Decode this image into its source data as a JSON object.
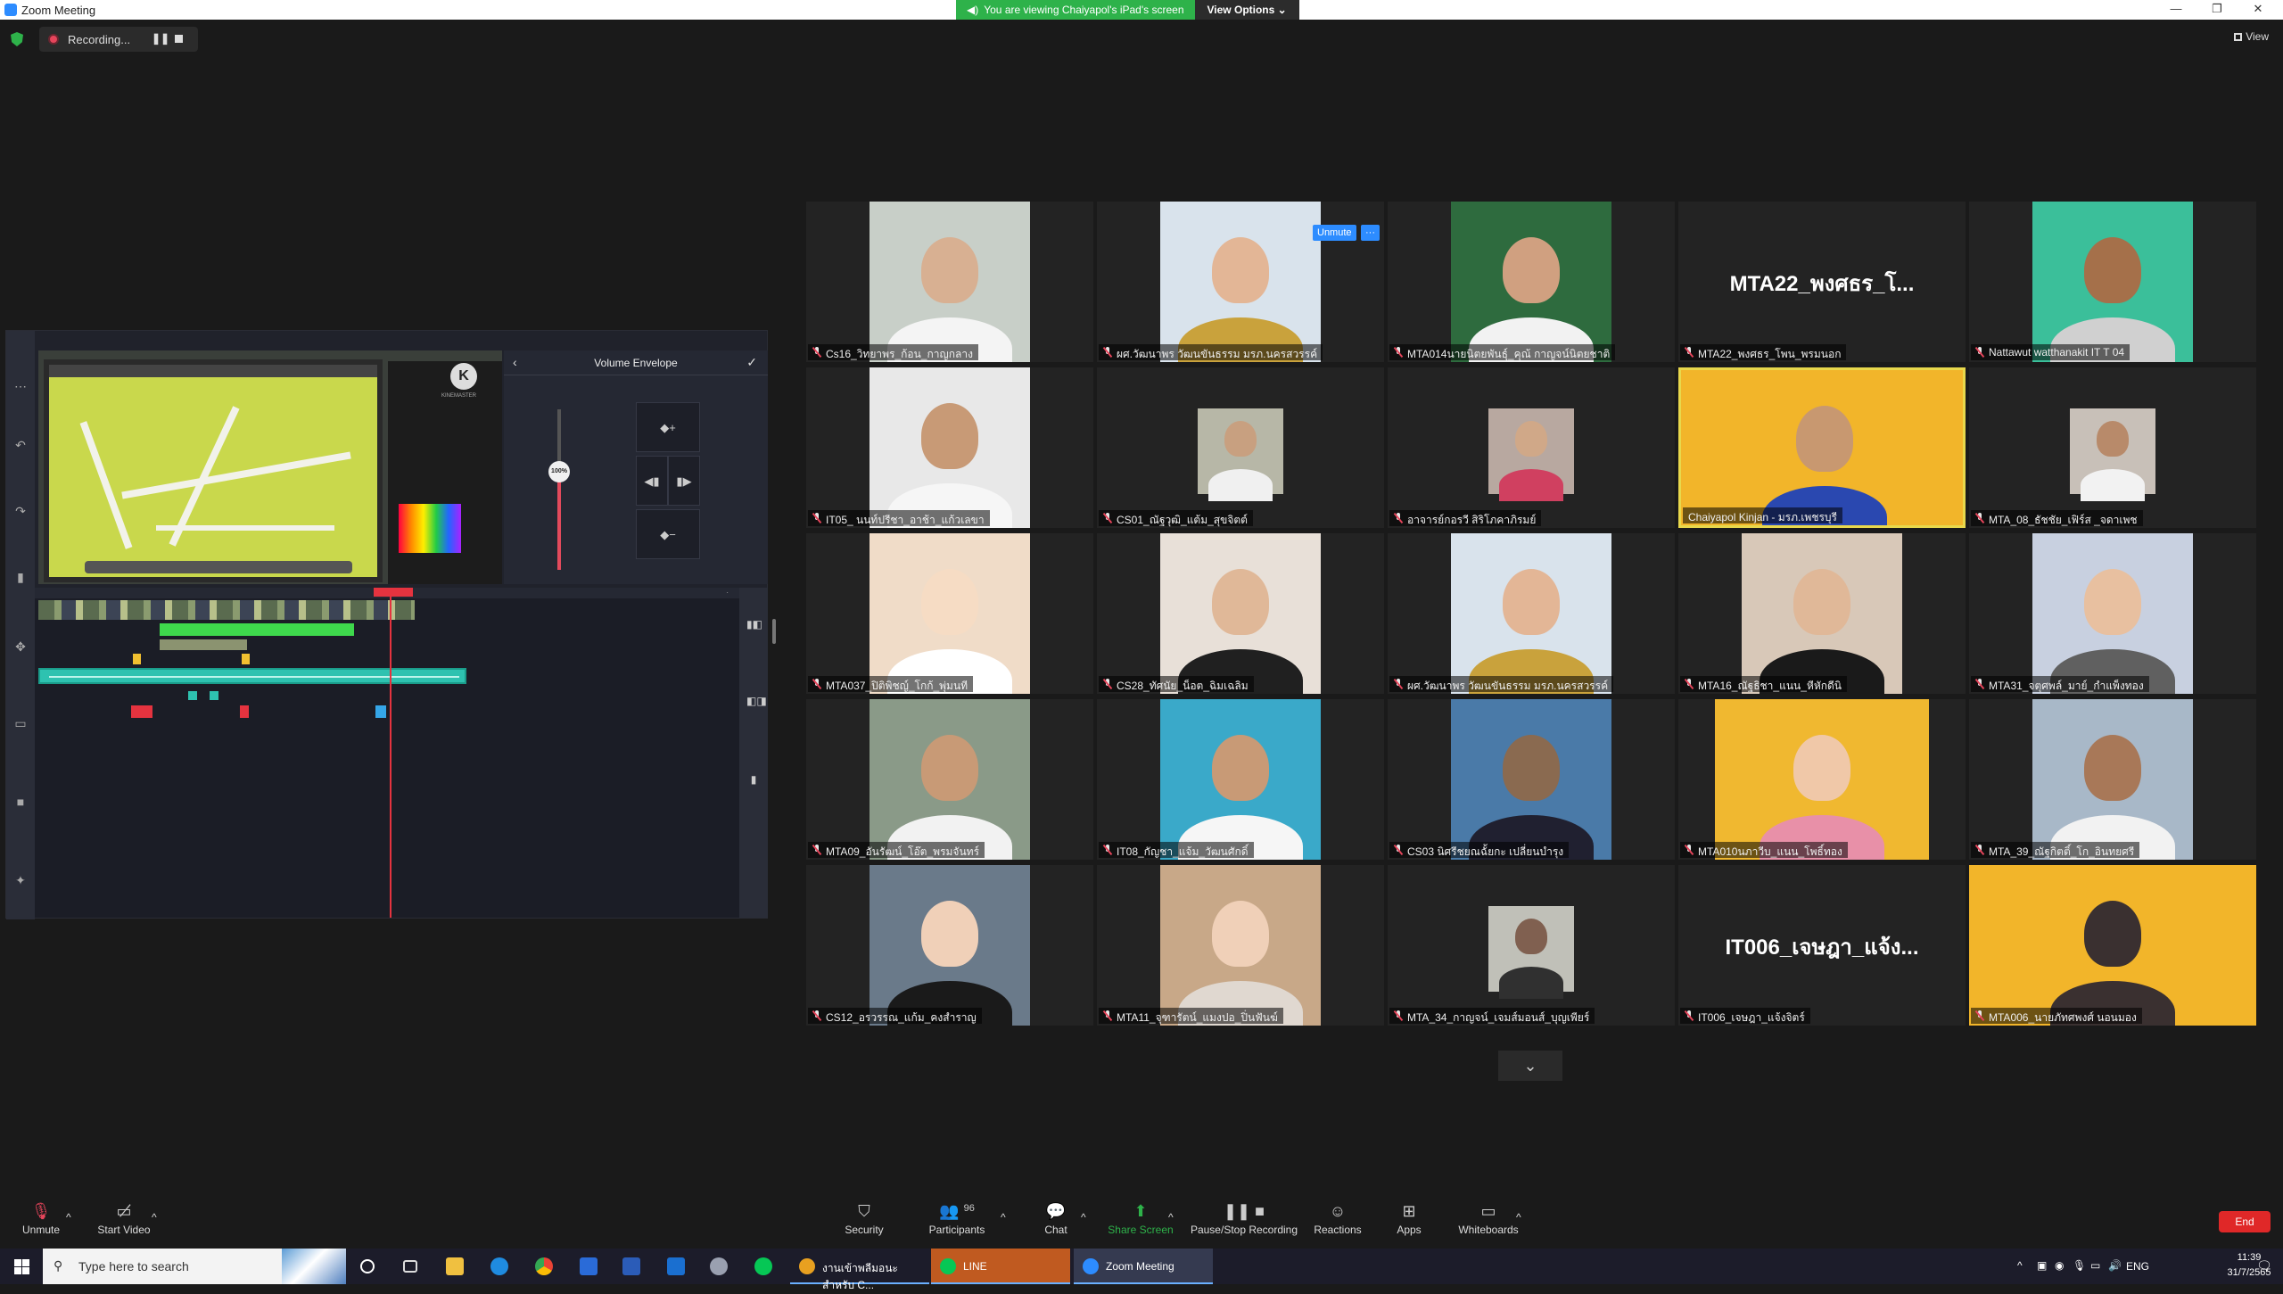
{
  "window": {
    "title": "Zoom Meeting",
    "share_banner": "You are viewing Chaiyapol's iPad's screen",
    "view_options": "View Options"
  },
  "recording": {
    "label": "Recording...",
    "pause_icon": "pause-icon",
    "stop_icon": "stop-icon"
  },
  "view_button": "View",
  "shared_app": {
    "panel_title": "Volume Envelope",
    "volume_value": "100%",
    "logo_text": "KINEMASTER"
  },
  "tile_controls": {
    "unmute": "Unmute",
    "more": "···"
  },
  "participants": [
    {
      "name": "Cs16_วิทยาพร_ก้อน_กาญกลาง",
      "muted": true,
      "kind": "video",
      "bg": "#c8cfc8",
      "skin": "#d8b092",
      "shirt": "#f4f4f4"
    },
    {
      "name": "ผศ.วัฒนาพร วัฒนขันธรรม มรภ.นครสวรรค์",
      "muted": true,
      "kind": "video",
      "bg": "#d9e3ec",
      "skin": "#e3b696",
      "shirt": "#c9a23c"
    },
    {
      "name": "MTA014นายนิตยพันธุ์_คุณ้ กาญจน์นิตยชาติ",
      "muted": true,
      "kind": "video",
      "bg": "#2e6b3e",
      "skin": "#d0a080",
      "shirt": "#f2f2f2"
    },
    {
      "name": "MTA22_พงศธร_โพน_พรมนอก",
      "muted": true,
      "kind": "name",
      "display": "MTA22_พงศธร_โ..."
    },
    {
      "name": "Nattawut watthanakit IT T 04",
      "muted": true,
      "kind": "video",
      "bg": "#3bbf9a",
      "skin": "#a5704a",
      "shirt": "#d0d0d0"
    },
    {
      "name": "IT05_ นนท์ปรีชา_อาช้า_แก้วเลขา",
      "muted": true,
      "kind": "video",
      "bg": "#e8e8e8",
      "skin": "#c89a76",
      "shirt": "#f6f6f6"
    },
    {
      "name": "CS01_ณัฐวุฒิ_แต้ม_สุขจิตต์",
      "muted": true,
      "kind": "small",
      "bg": "#b7b7a7",
      "skin": "#c8a080",
      "shirt": "#f0f0f0"
    },
    {
      "name": "อาจารย์กอรวี สิริโภคาภิรมย์",
      "muted": true,
      "kind": "small",
      "bg": "#b8a8a0",
      "skin": "#d0a888",
      "shirt": "#d04060"
    },
    {
      "name": "Chaiyapol Kinjan - มรภ.เพชรบุรี",
      "muted": false,
      "kind": "active",
      "bg": "#f2b52a",
      "skin": "#c89870",
      "shirt": "#2a48b0"
    },
    {
      "name": "MTA_08_ธัชชัย_เฟิร์ส _จดาเพช",
      "muted": true,
      "kind": "small",
      "bg": "#c8c0b8",
      "skin": "#b88a6a",
      "shirt": "#f2f2f2"
    },
    {
      "name": "MTA037_ปิติพิชญ์_โกก้_พุ่มนที",
      "muted": true,
      "kind": "video",
      "bg": "#f0dcc8",
      "skin": "#f6dcc4",
      "shirt": "#ffffff"
    },
    {
      "name": "CS28_ทัศนัย_น็อต_ฉิมเฉลิม",
      "muted": true,
      "kind": "video",
      "bg": "#e8e0d8",
      "skin": "#e0b898",
      "shirt": "#202020"
    },
    {
      "name": "ผศ.วัฒนาพร วัฒนขันธรรม มรภ.นครสวรรค์",
      "muted": true,
      "kind": "video",
      "bg": "#d9e3ec",
      "skin": "#e3b696",
      "shirt": "#c9a23c"
    },
    {
      "name": "MTA16_ณัฐธิชา_แนน_หีหักดีนิ",
      "muted": true,
      "kind": "video",
      "bg": "#d8c8b8",
      "skin": "#e0b898",
      "shirt": "#1a1a1a"
    },
    {
      "name": "MTA31_จตุศพล์_มาย์_กำแพ็งทอง",
      "muted": true,
      "kind": "video",
      "bg": "#c8d0e0",
      "skin": "#e8c0a0",
      "shirt": "#606060"
    },
    {
      "name": "MTA09_อันรัฒน์_โอ๊ต_พรมจันทร์",
      "muted": true,
      "kind": "video",
      "bg": "#8a9a88",
      "skin": "#c89a76",
      "shirt": "#f2f2f2"
    },
    {
      "name": "IT08_กัญชา_แจ้ม_วัฒนศักดิ์",
      "muted": true,
      "kind": "video",
      "bg": "#3aa9c9",
      "skin": "#c89a76",
      "shirt": "#f6f6f6"
    },
    {
      "name": "CS03 นิศรีชยณฉั้ยกะ เปลี่ยนบำรุง",
      "muted": true,
      "kind": "video",
      "bg": "#4a7aa8",
      "skin": "#8a6a50",
      "shirt": "#202030"
    },
    {
      "name": "MTA010นภาวีบ_แนน_โพธิ์ทอง",
      "muted": true,
      "kind": "w240",
      "bg": "#f0b830",
      "skin": "#f0c8a8",
      "shirt": "#e890a8"
    },
    {
      "name": "MTA_39_ณัฐกิตติ์_โก_อินทยศรี",
      "muted": true,
      "kind": "video",
      "bg": "#a8b8c8",
      "skin": "#a87858",
      "shirt": "#f2f2f2"
    },
    {
      "name": "CS12_อรวรรณ_แก้ม_คงสำราญ",
      "muted": true,
      "kind": "video",
      "bg": "#6a7a8a",
      "skin": "#f0d0b8",
      "shirt": "#1a1a1a"
    },
    {
      "name": "MTA11_จุฑารัตน์_แมงปอ_ปิ่นฟันฆ์",
      "muted": true,
      "kind": "video",
      "bg": "#c8a888",
      "skin": "#f0d0b8",
      "shirt": "#e0d8d0"
    },
    {
      "name": "MTA_34_กาญจน์_เจมส์มอนส์_บุญเพียร์",
      "muted": true,
      "kind": "small",
      "bg": "#c0c0b8",
      "skin": "#806050",
      "shirt": "#303030"
    },
    {
      "name": "IT006_เจษฎา_แจ้งจิตร์",
      "muted": true,
      "kind": "name",
      "display": "IT006_เจษฎา_แจ้ง..."
    },
    {
      "name": "MTA006_นายภัทศพงศ์ นอนมอง",
      "muted": true,
      "kind": "wide",
      "bg": "#f2b52a",
      "skin": "#3a3030",
      "shirt": "#3a3030"
    }
  ],
  "toolbar": {
    "unmute": "Unmute",
    "start_video": "Start Video",
    "security": "Security",
    "participants": "Participants",
    "participant_count": "96",
    "chat": "Chat",
    "share_screen": "Share Screen",
    "pause_stop_recording": "Pause/Stop Recording",
    "reactions": "Reactions",
    "apps": "Apps",
    "whiteboards": "Whiteboards",
    "end": "End"
  },
  "taskbar": {
    "search_placeholder": "Type here to search",
    "apps": [
      {
        "label": "งานเข้าพลีมอนะสำหรับ C...",
        "color": "#e8a020"
      },
      {
        "label": "LINE",
        "color": "#06c755"
      },
      {
        "label": "Zoom Meeting",
        "color": "#2d8cff"
      }
    ],
    "lang": "ENG",
    "time": "11:39",
    "date": "31/7/2565"
  },
  "colors": {
    "zoom_blue": "#2d8cff",
    "share_green": "#2eb24a",
    "end_red": "#e02828",
    "active_speaker": "#e8d84c",
    "kinemaster_red": "#e5333f"
  }
}
